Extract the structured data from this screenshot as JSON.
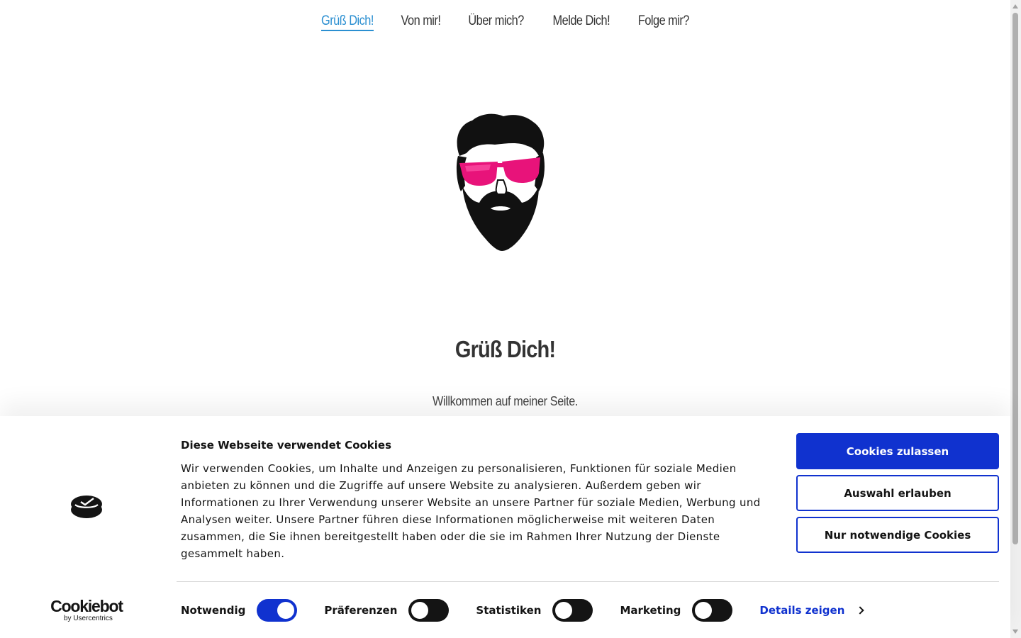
{
  "nav": {
    "items": [
      {
        "label": "Grüß Dich!",
        "active": true
      },
      {
        "label": "Von mir!",
        "active": false
      },
      {
        "label": "Über mich?",
        "active": false
      },
      {
        "label": "Melde Dich!",
        "active": false
      },
      {
        "label": "Folge mir?",
        "active": false
      }
    ],
    "active_color": "#2b8fd1"
  },
  "hero": {
    "logo_icon": "bearded-man-pink-sunglasses-logo",
    "title": "Grüß Dich!",
    "subtitle": "Willkommen auf meiner Seite."
  },
  "cookie_banner": {
    "brand": {
      "name": "Cookiebot",
      "by": "by Usercentrics",
      "icon": "cookiebot-icon"
    },
    "title": "Diese Webseite verwendet Cookies",
    "text": "Wir verwenden Cookies, um Inhalte und Anzeigen zu personalisieren, Funktionen für soziale Medien anbieten zu können und die Zugriffe auf unsere Website zu analysieren. Außerdem geben wir Informationen zu Ihrer Verwendung unserer Website an unsere Partner für soziale Medien, Werbung und Analysen weiter. Unsere Partner führen diese Informationen möglicherweise mit weiteren Daten zusammen, die Sie ihnen bereitgestellt haben oder die sie im Rahmen Ihrer Nutzung der Dienste gesammelt haben.",
    "buttons": {
      "allow_all": "Cookies zulassen",
      "allow_selection": "Auswahl erlauben",
      "necessary_only": "Nur notwendige Cookies"
    },
    "toggles": [
      {
        "label": "Notwendig",
        "on": true
      },
      {
        "label": "Präferenzen",
        "on": false
      },
      {
        "label": "Statistiken",
        "on": false
      },
      {
        "label": "Marketing",
        "on": false
      }
    ],
    "details_label": "Details zeigen",
    "accent_color": "#1032cf"
  }
}
